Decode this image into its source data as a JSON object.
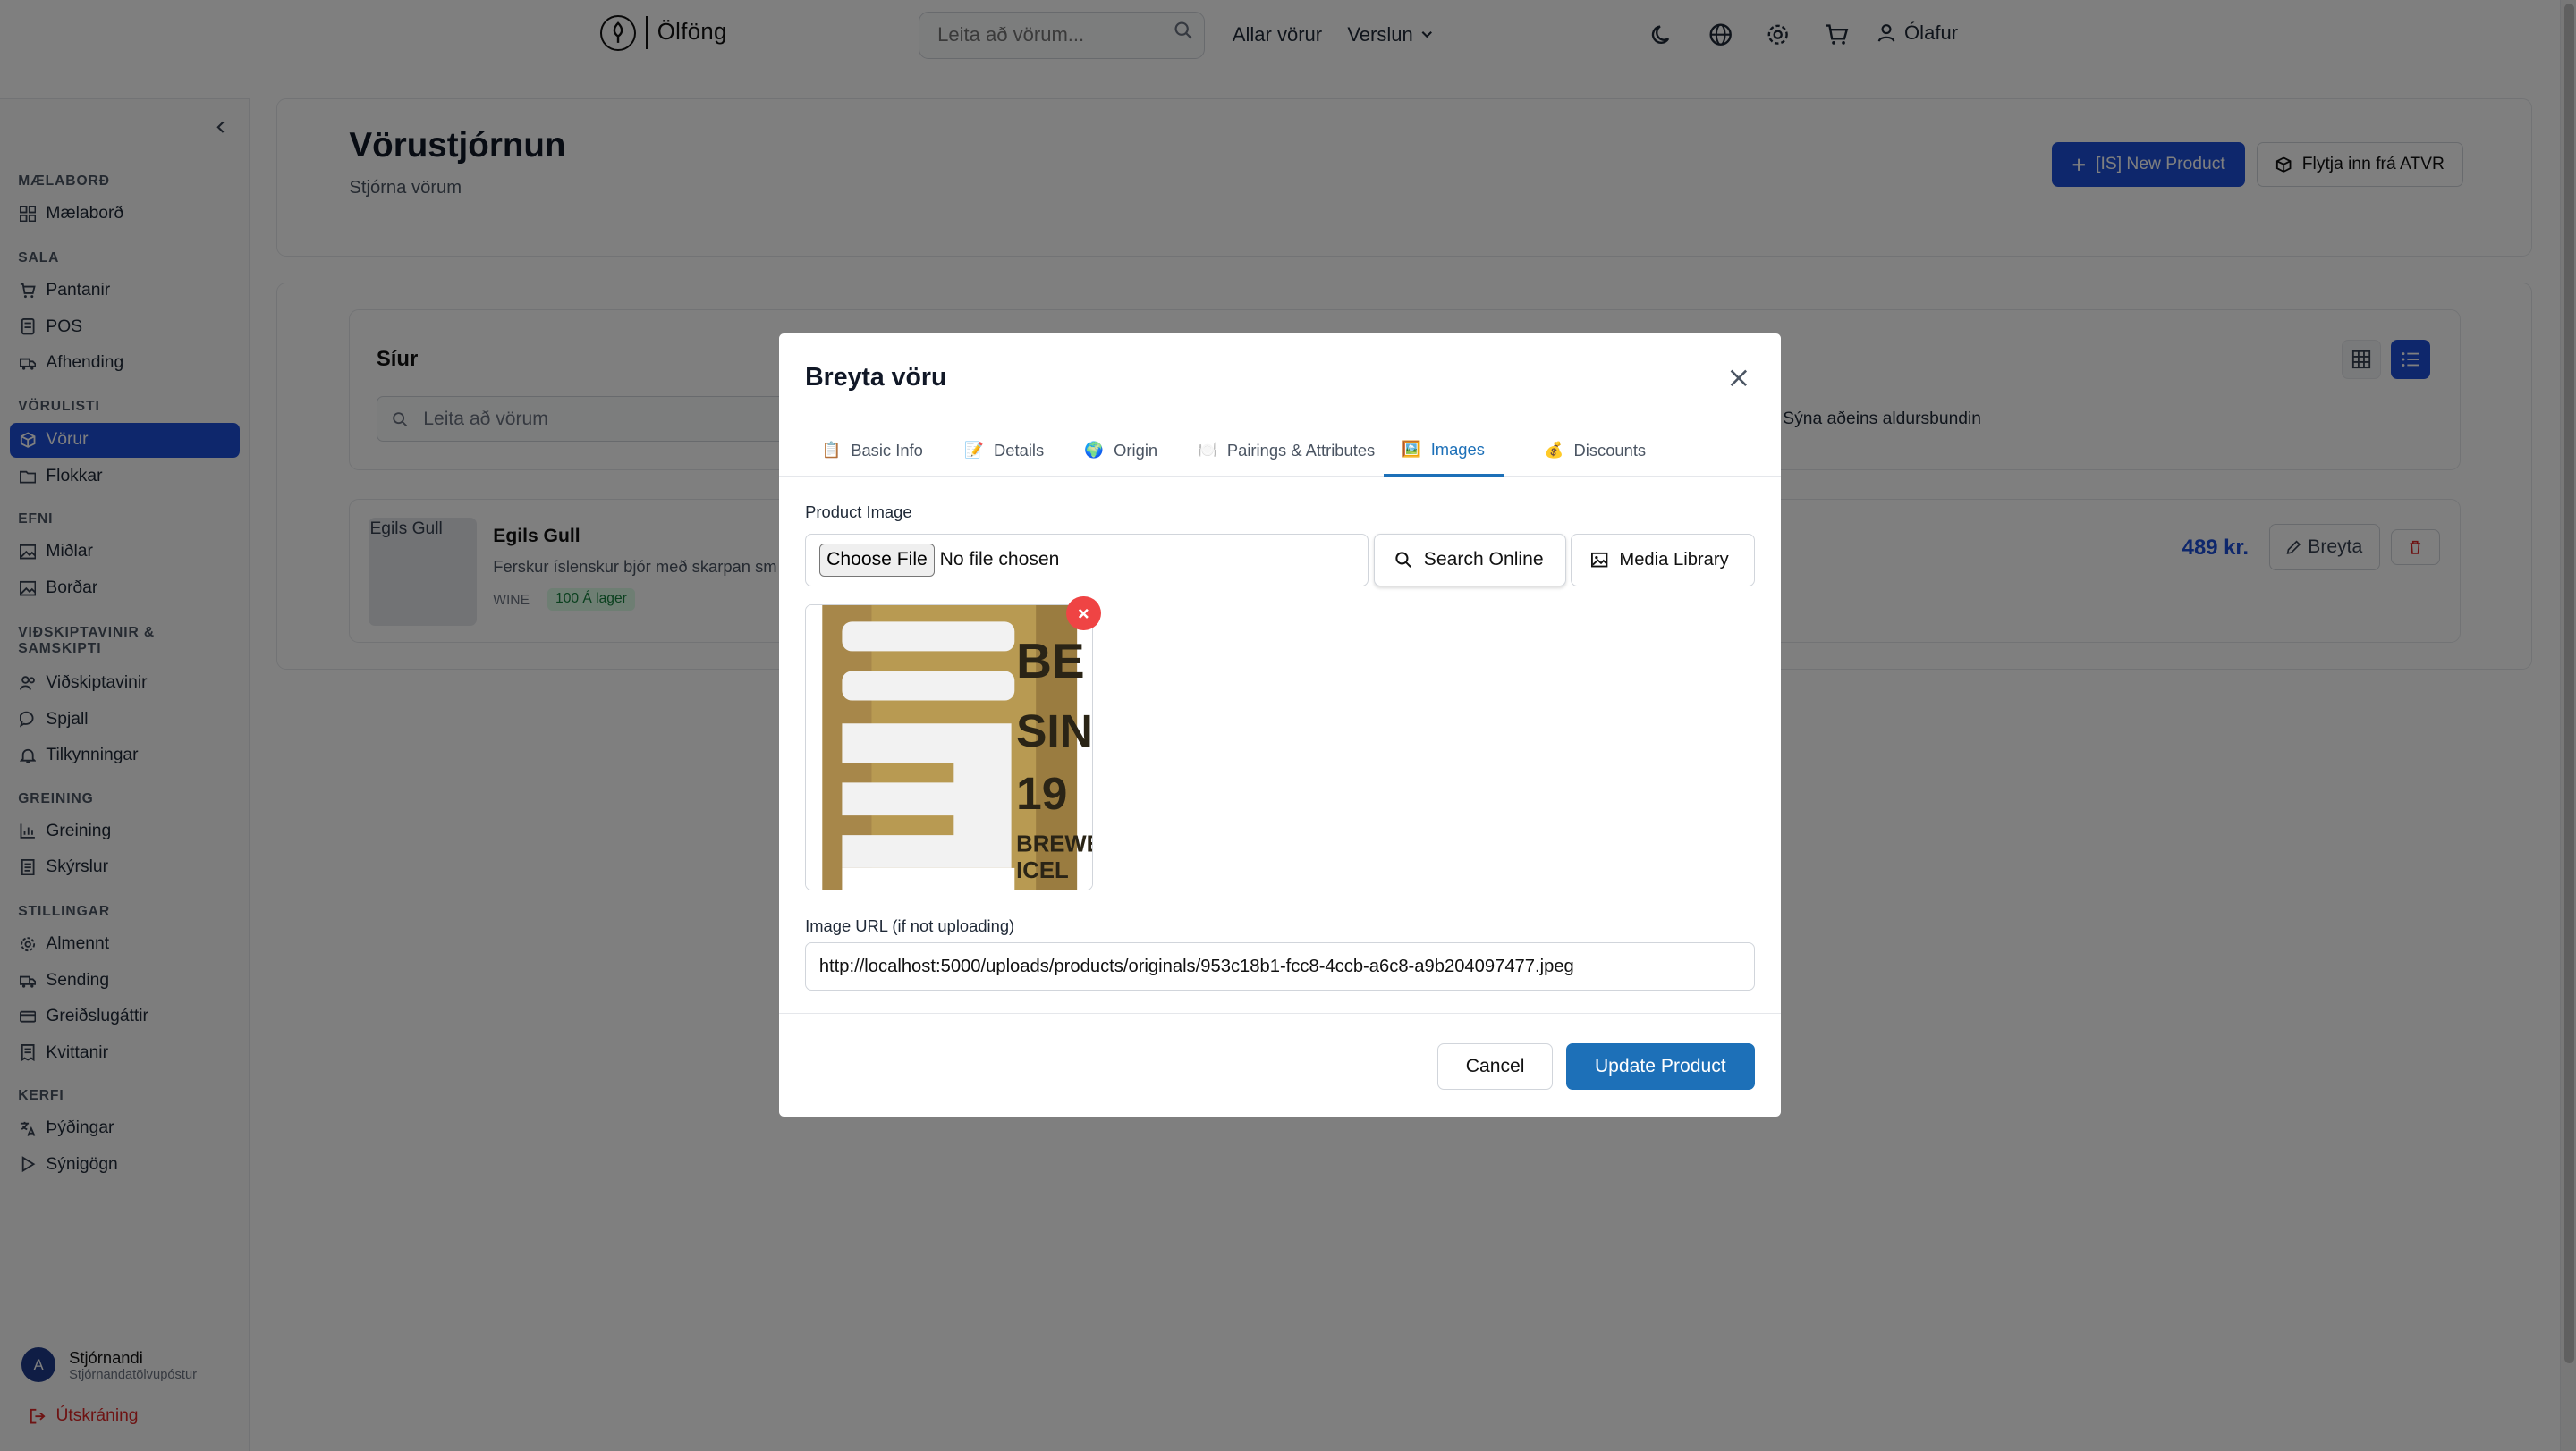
{
  "topnav": {
    "logo_text": "Ölföng",
    "search_placeholder": "Leita að vörum...",
    "links": [
      "Allar vörur",
      "Verslun"
    ],
    "user_name": "Ólafur",
    "icons": [
      "moon-icon",
      "globe-icon",
      "gear-icon",
      "cart-icon",
      "user-icon"
    ]
  },
  "sidebar": {
    "sections": [
      {
        "title": "MÆLABORÐ",
        "items": [
          {
            "label": "Mælaborð",
            "icon": "grid-icon"
          }
        ]
      },
      {
        "title": "SALA",
        "items": [
          {
            "label": "Pantanir",
            "icon": "cart-icon"
          },
          {
            "label": "POS",
            "icon": "calculator-icon"
          },
          {
            "label": "Afhending",
            "icon": "truck-icon"
          }
        ]
      },
      {
        "title": "VÖRULISTI",
        "items": [
          {
            "label": "Vörur",
            "icon": "box-icon",
            "active": true
          },
          {
            "label": "Flokkar",
            "icon": "folder-icon"
          }
        ]
      },
      {
        "title": "EFNI",
        "items": [
          {
            "label": "Miðlar",
            "icon": "image-icon"
          },
          {
            "label": "Borðar",
            "icon": "image-icon"
          }
        ]
      },
      {
        "title": "VIÐSKIPTAVINIR & SAMSKIPTI",
        "items": [
          {
            "label": "Viðskiptavinir",
            "icon": "users-icon"
          },
          {
            "label": "Spjall",
            "icon": "chat-icon"
          },
          {
            "label": "Tilkynningar",
            "icon": "bell-icon"
          }
        ]
      },
      {
        "title": "GREINING",
        "items": [
          {
            "label": "Greining",
            "icon": "chart-icon"
          },
          {
            "label": "Skýrslur",
            "icon": "report-icon"
          }
        ]
      },
      {
        "title": "STILLINGAR",
        "items": [
          {
            "label": "Almennt",
            "icon": "gear-icon"
          },
          {
            "label": "Sending",
            "icon": "truck-icon"
          },
          {
            "label": "Greiðslugáttir",
            "icon": "card-icon"
          },
          {
            "label": "Kvittanir",
            "icon": "receipt-icon"
          }
        ]
      },
      {
        "title": "KERFI",
        "items": [
          {
            "label": "Þýðingar",
            "icon": "translate-icon"
          },
          {
            "label": "Sýnigögn",
            "icon": "play-icon"
          }
        ]
      }
    ],
    "user": {
      "initial": "A",
      "name": "Stjórnandi",
      "email": "Stjórnandatölvupóstur"
    },
    "logout_label": "Útskráning"
  },
  "page": {
    "title": "Vörustjórnun",
    "subtitle": "Stjórna vörum",
    "new_product_label": "[IS] New Product",
    "import_label": "Flytja inn frá ATVR",
    "filters_title": "Síur",
    "filter_search_placeholder": "Leita að vörum",
    "age_filter_label": "Sýna aðeins aldursbundin",
    "product": {
      "image_alt": "Egils Gull",
      "name": "Egils Gull",
      "description": "Ferskur íslenskur bjór með skarpan sm",
      "category": "WINE",
      "stock": "100 Á lager",
      "price": "489 kr.",
      "edit_label": "Breyta"
    }
  },
  "modal": {
    "title": "Breyta vöru",
    "tabs": [
      {
        "emoji": "📋",
        "label": "Basic Info"
      },
      {
        "emoji": "📝",
        "label": "Details"
      },
      {
        "emoji": "🌍",
        "label": "Origin"
      },
      {
        "emoji": "🍽️",
        "label": "Pairings & Attributes"
      },
      {
        "emoji": "🖼️",
        "label": "Images",
        "active": true
      },
      {
        "emoji": "💰",
        "label": "Discounts"
      }
    ],
    "product_image_label": "Product Image",
    "choose_file_label": "Choose File",
    "no_file_text": "No file chosen",
    "search_online_label": "Search Online",
    "media_library_label": "Media Library",
    "image_url_label": "Image URL (if not uploading)",
    "image_url_value": "http://localhost:5000/uploads/products/originals/953c18b1-fcc8-4ccb-a6c8-a9b204097477.jpeg",
    "cancel_label": "Cancel",
    "update_label": "Update Product",
    "can_text": [
      "BE",
      "SIN",
      "19",
      "BREWE",
      "ICEL"
    ]
  }
}
